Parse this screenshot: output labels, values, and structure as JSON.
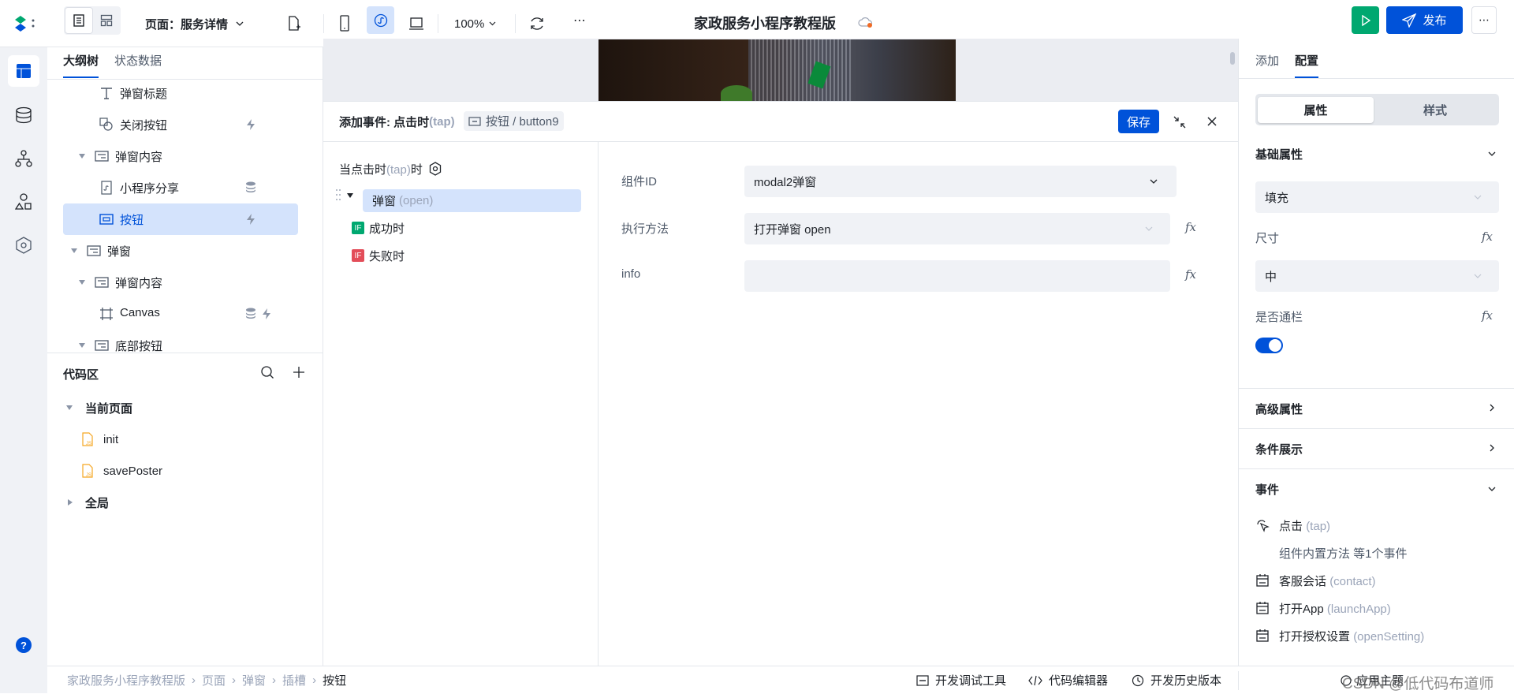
{
  "topbar": {
    "page_label": "页面：服务详情",
    "zoom": "100%",
    "app_title": "家政服务小程序教程版",
    "publish_label": "发布",
    "more": "⋯"
  },
  "colors": {
    "primary": "#0052d9",
    "run": "#00a870",
    "selected_bg": "#d4e3fc",
    "if_success": "#00a870",
    "if_fail": "#e34d59"
  },
  "left": {
    "tabs": [
      "大纲树",
      "状态数据"
    ],
    "tree": [
      {
        "label": "弹窗标题",
        "icon": "text-icon",
        "badges": []
      },
      {
        "label": "关闭按钮",
        "icon": "close-button-icon",
        "badges": [
          "lightning-icon"
        ]
      },
      {
        "label": "弹窗内容",
        "icon": "container-icon",
        "badges": []
      },
      {
        "label": "小程序分享",
        "icon": "share-icon",
        "badges": [
          "database-icon"
        ]
      },
      {
        "label": "按钮",
        "icon": "button-icon",
        "badges": [
          "lightning-icon"
        ],
        "selected": true
      },
      {
        "label": "弹窗",
        "icon": "container-icon",
        "badges": []
      },
      {
        "label": "弹窗内容",
        "icon": "container-icon",
        "badges": []
      },
      {
        "label": "Canvas",
        "icon": "canvas-icon",
        "badges": [
          "database-icon",
          "lightning-icon"
        ]
      },
      {
        "label": "底部按钮",
        "icon": "container-icon",
        "badges": []
      }
    ],
    "code": {
      "title": "代码区",
      "current_page": "当前页面",
      "files": [
        "init",
        "savePoster"
      ],
      "global": "全局"
    }
  },
  "event": {
    "title": "添加事件: 点击时",
    "title_suffix": "(tap)",
    "component_tag": "按钮 / button9",
    "save_label": "保存",
    "trigger_prefix": "当点击时",
    "trigger_mid": "(tap)",
    "trigger_suffix": "时",
    "action_label": "弹窗",
    "action_method": "(open)",
    "success_label": "成功时",
    "fail_label": "失败时",
    "if_badge": "IF",
    "form": [
      {
        "label": "组件ID",
        "value": "modal2弹窗"
      },
      {
        "label": "执行方法",
        "value": "打开弹窗 open"
      },
      {
        "label": "info",
        "value": ""
      }
    ]
  },
  "right": {
    "tabs": [
      "添加",
      "配置"
    ],
    "segments": [
      "属性",
      "样式"
    ],
    "basic_title": "基础属性",
    "fill_value": "填充",
    "size_label": "尺寸",
    "size_value": "中",
    "fullwidth_label": "是否通栏",
    "fullwidth_on": true,
    "advanced_title": "高级属性",
    "condition_title": "条件展示",
    "events_title": "事件",
    "fx": "fx",
    "events": [
      {
        "name": "点击",
        "code": "(tap)",
        "icon": "tap-icon"
      },
      {
        "name": "客服会话",
        "code": "(contact)",
        "icon": "event-icon"
      },
      {
        "name": "打开App",
        "code": "(launchApp)",
        "icon": "event-icon"
      },
      {
        "name": "打开授权设置",
        "code": "(openSetting)",
        "icon": "event-icon"
      }
    ],
    "tap_summary": "组件内置方法 等1个事件"
  },
  "bottom": {
    "breadcrumb": [
      "家政服务小程序教程版",
      "页面",
      "弹窗",
      "插槽",
      "按钮"
    ],
    "tools": [
      "开发调试工具",
      "代码编辑器",
      "开发历史版本"
    ],
    "theme": "应用主题",
    "watermark": "CSDN @低代码布道师"
  }
}
